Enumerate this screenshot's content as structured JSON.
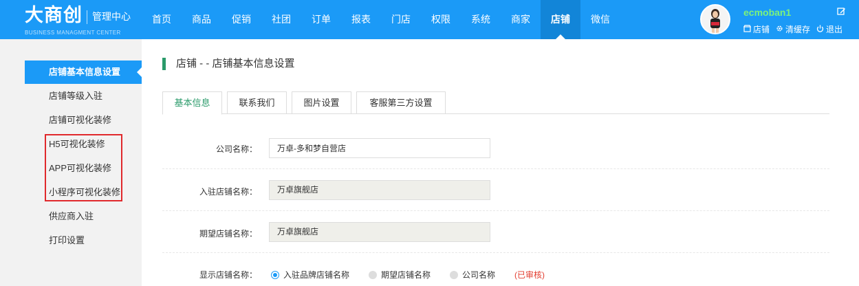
{
  "logo": {
    "main": "大商创",
    "sub": "管理中心",
    "en": "BUSINESS MANAGMENT CENTER"
  },
  "nav": [
    {
      "label": "首页"
    },
    {
      "label": "商品"
    },
    {
      "label": "促销"
    },
    {
      "label": "社团"
    },
    {
      "label": "订单"
    },
    {
      "label": "报表"
    },
    {
      "label": "门店"
    },
    {
      "label": "权限"
    },
    {
      "label": "系统"
    },
    {
      "label": "商家"
    },
    {
      "label": "店铺",
      "active": true
    },
    {
      "label": "微信"
    }
  ],
  "user": {
    "name": "ecmoban1",
    "links": [
      {
        "icon": "store-icon",
        "label": "店铺"
      },
      {
        "icon": "gear-icon",
        "label": "清缓存"
      },
      {
        "icon": "power-icon",
        "label": "退出"
      }
    ]
  },
  "sidebar": {
    "items": [
      {
        "label": "店铺基本信息设置",
        "active": true
      },
      {
        "label": "店铺等级入驻"
      },
      {
        "label": "店铺可视化装修"
      },
      {
        "label": "H5可视化装修"
      },
      {
        "label": "APP可视化装修"
      },
      {
        "label": "小程序可视化装修"
      },
      {
        "label": "供应商入驻"
      },
      {
        "label": "打印设置"
      }
    ]
  },
  "main": {
    "title": "店铺 - - 店铺基本信息设置",
    "tabs": [
      {
        "label": "基本信息",
        "active": true
      },
      {
        "label": "联系我们"
      },
      {
        "label": "图片设置"
      },
      {
        "label": "客服第三方设置"
      }
    ],
    "form": {
      "company_label": "公司名称：",
      "company_value": "万卓-多和梦自营店",
      "shop_label": "入驻店铺名称：",
      "shop_value": "万卓旗舰店",
      "expect_label": "期望店铺名称：",
      "expect_value": "万卓旗舰店",
      "display_label": "显示店铺名称：",
      "display_options": [
        {
          "label": "入驻品牌店铺名称",
          "checked": true
        },
        {
          "label": "期望店铺名称"
        },
        {
          "label": "公司名称"
        }
      ],
      "status": "(已审核)"
    }
  },
  "colors": {
    "primary": "#1b9af7",
    "accent_green": "#2a9a6a",
    "highlight_red": "#e0282b"
  }
}
